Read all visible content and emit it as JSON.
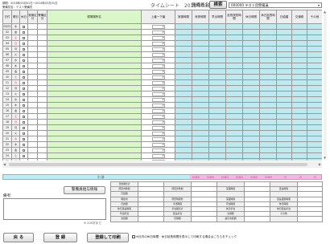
{
  "header": {
    "period": "期間：2018年03月01日～2018年03月31日",
    "worker": "警備員名：テスト警備員",
    "title": "タイムシート　2018年03月分",
    "search_label": "警備員名：",
    "search_button": "検索",
    "guard_selected": "000000 テスト用警備員"
  },
  "grid": {
    "headers": [
      "日付",
      "曜日",
      "休日",
      "実働区分",
      "警備区分",
      "現場場所名",
      "上番一下番",
      "実働時間",
      "深夜時間",
      "早出時間",
      "延長夜勤時間",
      "休日時間",
      "休日延長時間",
      "日給額",
      "交通費",
      "その他"
    ],
    "rows": [
      {
        "date": "03/01",
        "weekday": "木",
        "weekday_color": "normal",
        "holiday": "",
        "work": "",
        "guard": "",
        "site": ""
      },
      {
        "date": "02",
        "weekday": "金",
        "weekday_color": "normal",
        "holiday": "",
        "work": "",
        "guard": "",
        "site": ""
      },
      {
        "date": "03",
        "weekday": "土",
        "weekday_color": "sat",
        "holiday": "",
        "work": "",
        "guard": "",
        "site": ""
      },
      {
        "date": "04",
        "weekday": "日",
        "weekday_color": "sun",
        "holiday": "",
        "work": "",
        "guard": "",
        "site": ""
      },
      {
        "date": "05",
        "weekday": "月",
        "weekday_color": "normal",
        "holiday": "",
        "work": "",
        "guard": "",
        "site": ""
      },
      {
        "date": "06",
        "weekday": "火",
        "weekday_color": "normal",
        "holiday": "",
        "work": "",
        "guard": "",
        "site": ""
      },
      {
        "date": "07",
        "weekday": "水",
        "weekday_color": "normal",
        "holiday": "",
        "work": "",
        "guard": "",
        "site": ""
      },
      {
        "date": "08",
        "weekday": "木",
        "weekday_color": "normal",
        "holiday": "",
        "work": "",
        "guard": "",
        "site": ""
      },
      {
        "date": "09",
        "weekday": "金",
        "weekday_color": "normal",
        "holiday": "",
        "work": "",
        "guard": "",
        "site": ""
      },
      {
        "date": "10",
        "weekday": "土",
        "weekday_color": "sat",
        "holiday": "",
        "work": "",
        "guard": "",
        "site": ""
      },
      {
        "date": "11",
        "weekday": "日",
        "weekday_color": "sun",
        "holiday": "",
        "work": "",
        "guard": "",
        "site": ""
      },
      {
        "date": "12",
        "weekday": "月",
        "weekday_color": "normal",
        "holiday": "",
        "work": "",
        "guard": "",
        "site": ""
      },
      {
        "date": "13",
        "weekday": "火",
        "weekday_color": "normal",
        "holiday": "",
        "work": "",
        "guard": "",
        "site": ""
      },
      {
        "date": "14",
        "weekday": "水",
        "weekday_color": "normal",
        "holiday": "",
        "work": "",
        "guard": "",
        "site": ""
      },
      {
        "date": "15",
        "weekday": "木",
        "weekday_color": "normal",
        "holiday": "",
        "work": "",
        "guard": "",
        "site": ""
      },
      {
        "date": "16",
        "weekday": "金",
        "weekday_color": "normal",
        "holiday": "",
        "work": "",
        "guard": "",
        "site": ""
      },
      {
        "date": "17",
        "weekday": "土",
        "weekday_color": "sat",
        "holiday": "",
        "work": "",
        "guard": "",
        "site": ""
      },
      {
        "date": "18",
        "weekday": "日",
        "weekday_color": "sun",
        "holiday": "",
        "work": "",
        "guard": "",
        "site": ""
      },
      {
        "date": "19",
        "weekday": "月",
        "weekday_color": "normal",
        "holiday": "",
        "work": "",
        "guard": "",
        "site": ""
      },
      {
        "date": "20",
        "weekday": "火",
        "weekday_color": "normal",
        "holiday": "",
        "work": "",
        "guard": "",
        "site": ""
      },
      {
        "date": "21",
        "weekday": "水",
        "weekday_color": "sun",
        "holiday": "",
        "work": "",
        "guard": "",
        "site": ""
      },
      {
        "date": "22",
        "weekday": "木",
        "weekday_color": "normal",
        "holiday": "",
        "work": "",
        "guard": "",
        "site": ""
      },
      {
        "date": "23",
        "weekday": "金",
        "weekday_color": "normal",
        "holiday": "",
        "work": "",
        "guard": "",
        "site": ""
      },
      {
        "date": "24",
        "weekday": "土",
        "weekday_color": "sat",
        "holiday": "",
        "work": "",
        "guard": "",
        "site": ""
      },
      {
        "date": "25",
        "weekday": "日",
        "weekday_color": "sun",
        "holiday": "",
        "work": "",
        "guard": "",
        "site": ""
      },
      {
        "date": "26",
        "weekday": "月",
        "weekday_color": "normal",
        "holiday": "",
        "work": "",
        "guard": "",
        "site": ""
      },
      {
        "date": "27",
        "weekday": "火",
        "weekday_color": "normal",
        "holiday": "",
        "work": "",
        "guard": "",
        "site": ""
      }
    ]
  },
  "totals": {
    "label": "小 計",
    "values": [
      "0:00",
      "0:00",
      "0:00",
      "0:00",
      "0:00",
      "0:00",
      "0",
      "0",
      "0"
    ]
  },
  "info_button": "警備員給与情報",
  "remarks": {
    "label": "備考:",
    "limit": "※ 200字まで"
  },
  "summary": {
    "rows": [
      [
        "日給額合計",
        "",
        "",
        "",
        "",
        "",
        "",
        ""
      ],
      [
        "所定内時間",
        "",
        "所定外時間",
        "",
        "深夜時間",
        "",
        "延長時間",
        ""
      ],
      [
        "日給額",
        "",
        "",
        "",
        "",
        "",
        "",
        ""
      ],
      [
        "時給内",
        "",
        "所定時間外",
        "",
        "深夜時間",
        "",
        "延長夜勤時間",
        ""
      ],
      [
        "日給額",
        "",
        "手当時間",
        "",
        "早出時間",
        "",
        "休日時間",
        ""
      ],
      [
        "休日延長時間",
        "",
        "手当額合計",
        "",
        "休日手当",
        "",
        "休日延長手当",
        ""
      ],
      [
        "早出手当",
        "",
        "延長手当",
        "",
        "交通費",
        "",
        "その他",
        ""
      ],
      [
        "支給額",
        "",
        "控除額",
        "",
        "差引支給額",
        "",
        "",
        ""
      ]
    ]
  },
  "buttons": {
    "back": "戻 る",
    "register": "登 録",
    "register_print": "登録して印刷"
  },
  "print_option": "※社内の休日時間・休日延長時間を表示して印刷する場合はこちらをチェック",
  "colors": {
    "site_column": "#d9f7c8",
    "time_columns": "#bde9ef",
    "totals_pink": "#f7b7e6",
    "totals_text": "#d61b8a",
    "weekend_text": "#d3325a"
  }
}
